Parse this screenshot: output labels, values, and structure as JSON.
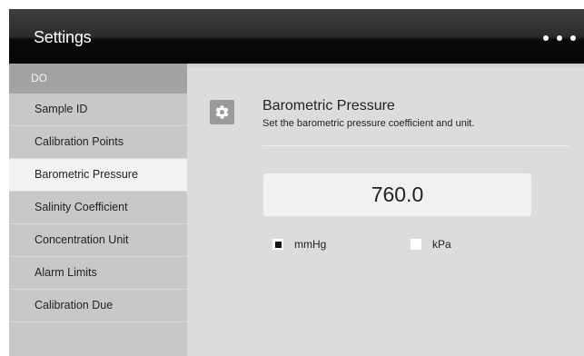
{
  "header": {
    "title": "Settings",
    "more_icon": "more-horizontal-icon"
  },
  "sidebar": {
    "group_label": "DO",
    "items": [
      {
        "label": "Sample ID",
        "active": false
      },
      {
        "label": "Calibration Points",
        "active": false
      },
      {
        "label": "Barometric Pressure",
        "active": true
      },
      {
        "label": "Salinity Coefficient",
        "active": false
      },
      {
        "label": "Concentration Unit",
        "active": false
      },
      {
        "label": "Alarm Limits",
        "active": false
      },
      {
        "label": "Calibration Due",
        "active": false
      }
    ]
  },
  "main": {
    "icon": "gear-icon",
    "title": "Barometric Pressure",
    "subtitle": "Set the barometric pressure coefficient and unit.",
    "value": "760.0",
    "units": [
      {
        "label": "mmHg",
        "selected": true
      },
      {
        "label": "kPa",
        "selected": false
      }
    ]
  }
}
